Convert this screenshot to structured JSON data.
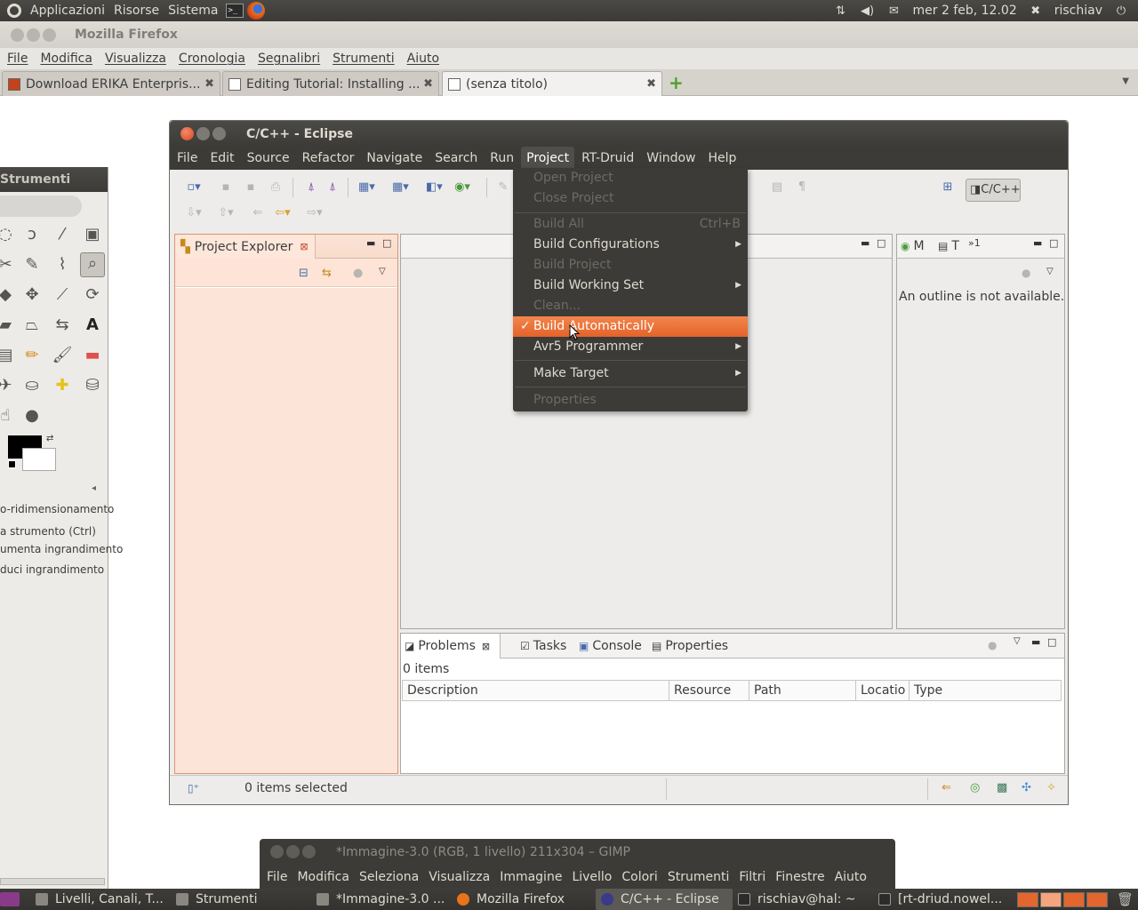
{
  "top_panel": {
    "menus": [
      "Applicazioni",
      "Risorse",
      "Sistema"
    ],
    "datetime": "mer  2 feb, 12.02",
    "user": "rischiav",
    "icons": [
      "ubuntu-logo-icon",
      "terminal-icon",
      "firefox-icon",
      "network-icon",
      "volume-icon",
      "mail-icon",
      "user-icon",
      "power-icon"
    ]
  },
  "firefox": {
    "title": "Mozilla Firefox",
    "menu": [
      "File",
      "Modifica",
      "Visualizza",
      "Cronologia",
      "Segnalibri",
      "Strumenti",
      "Aiuto"
    ],
    "tabs": [
      {
        "label": "Download ERIKA Enterpris...",
        "active": false
      },
      {
        "label": "Editing Tutorial: Installing ...",
        "active": false
      },
      {
        "label": "(senza titolo)",
        "active": true
      }
    ]
  },
  "gimp_toolbox": {
    "title": "Strumenti",
    "options": [
      "o-ridimensionamento",
      "a strumento (Ctrl)",
      "umenta ingrandimento",
      "duci ingrandimento"
    ]
  },
  "eclipse": {
    "title": "C/C++ - Eclipse",
    "menu": [
      "File",
      "Edit",
      "Source",
      "Refactor",
      "Navigate",
      "Search",
      "Run",
      "Project",
      "RT-Druid",
      "Window",
      "Help"
    ],
    "open_menu": "Project",
    "perspective": "C/C++",
    "project_explorer": {
      "tab": "Project Explorer"
    },
    "outline": {
      "tabs": [
        "M",
        "T",
        "»1"
      ],
      "message": "An outline is not available."
    },
    "bottom_views": {
      "tabs": [
        "Problems",
        "Tasks",
        "Console",
        "Properties"
      ],
      "count": "0 items",
      "columns": [
        "Description",
        "Resource",
        "Path",
        "Locatio",
        "Type"
      ]
    },
    "status": "0 items selected",
    "project_menu": [
      {
        "label": "Open Project",
        "enabled": false
      },
      {
        "label": "Close Project",
        "enabled": false
      },
      {
        "label": "Build All",
        "accel": "Ctrl+B",
        "enabled": false
      },
      {
        "label": "Build Configurations",
        "enabled": true,
        "submenu": true
      },
      {
        "label": "Build Project",
        "enabled": false
      },
      {
        "label": "Build Working Set",
        "enabled": true,
        "submenu": true
      },
      {
        "label": "Clean...",
        "enabled": false
      },
      {
        "label": "Build Automatically",
        "enabled": true,
        "checked": true,
        "highlighted": true
      },
      {
        "label": "Avr5 Programmer",
        "enabled": true,
        "submenu": true
      },
      {
        "label": "Make Target",
        "enabled": true,
        "submenu": true
      },
      {
        "label": "Properties",
        "enabled": false
      }
    ]
  },
  "gimp_image": {
    "title": "*Immagine-3.0 (RGB, 1 livello) 211x304 – GIMP",
    "menu": [
      "File",
      "Modifica",
      "Seleziona",
      "Visualizza",
      "Immagine",
      "Livello",
      "Colori",
      "Strumenti",
      "Filtri",
      "Finestre",
      "Aiuto"
    ]
  },
  "taskbar": {
    "items": [
      "Livelli, Canali, T...",
      "Strumenti",
      "*Immagine-3.0 ...",
      "Mozilla Firefox",
      "C/C++ - Eclipse",
      "rischiav@hal: ~",
      "[rt-driud.nowel..."
    ],
    "active": "C/C++ - Eclipse"
  }
}
